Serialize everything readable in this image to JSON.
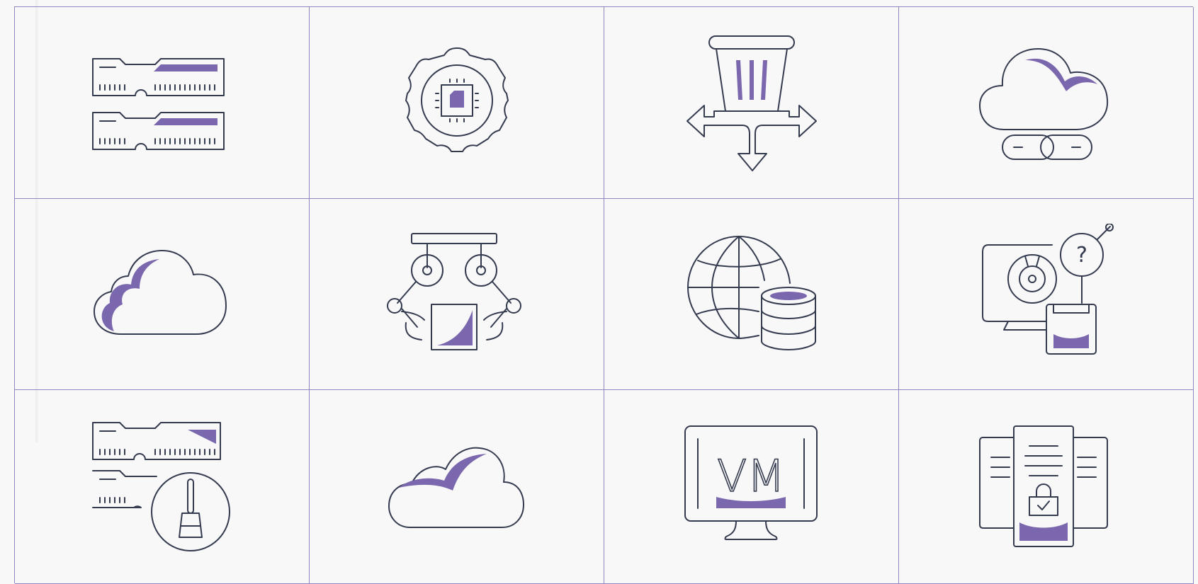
{
  "palette": {
    "stroke": "#353b4f",
    "accent": "#7a67ad",
    "grid_line": "#8f86c2",
    "background": "#f8f8f9"
  },
  "icon_grid": {
    "icons": [
      {
        "name": "memory-modules-icon"
      },
      {
        "name": "gear-chip-icon"
      },
      {
        "name": "trash-distribute-icon"
      },
      {
        "name": "cloud-link-icon"
      },
      {
        "name": "cloud-icon"
      },
      {
        "name": "robotic-arms-icon"
      },
      {
        "name": "globe-database-icon"
      },
      {
        "name": "disk-monitor-help-icon"
      },
      {
        "name": "memory-cleanup-icon"
      },
      {
        "name": "cloud-small-icon"
      },
      {
        "name": "vm-monitor-icon"
      },
      {
        "name": "secure-document-icon"
      }
    ],
    "vm_label": "VM"
  }
}
